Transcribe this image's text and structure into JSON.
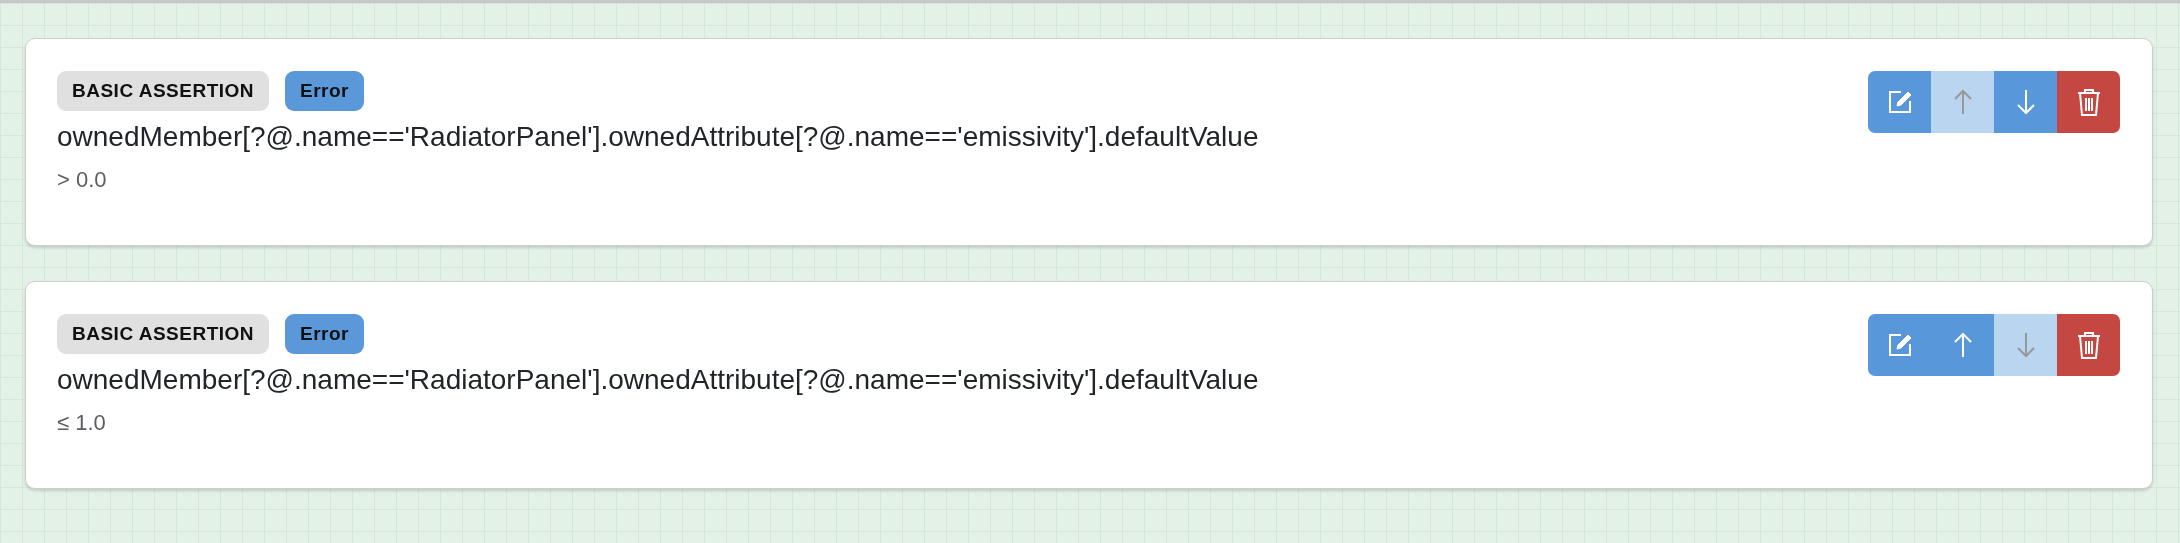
{
  "assertions": [
    {
      "type_label": "BASIC ASSERTION",
      "severity": "Error",
      "path": "ownedMember[?@.name=='RadiatorPanel'].ownedAttribute[?@.name=='emissivity'].defaultValue",
      "condition": "> 0.0",
      "actions": [
        {
          "kind": "edit",
          "disabled": false
        },
        {
          "kind": "up",
          "disabled": true
        },
        {
          "kind": "down",
          "disabled": false
        },
        {
          "kind": "delete",
          "disabled": false
        }
      ]
    },
    {
      "type_label": "BASIC ASSERTION",
      "severity": "Error",
      "path": "ownedMember[?@.name=='RadiatorPanel'].ownedAttribute[?@.name=='emissivity'].defaultValue",
      "condition": "≤ 1.0",
      "actions": [
        {
          "kind": "edit",
          "disabled": false
        },
        {
          "kind": "up",
          "disabled": false
        },
        {
          "kind": "down",
          "disabled": true
        },
        {
          "kind": "delete",
          "disabled": false
        }
      ]
    }
  ]
}
